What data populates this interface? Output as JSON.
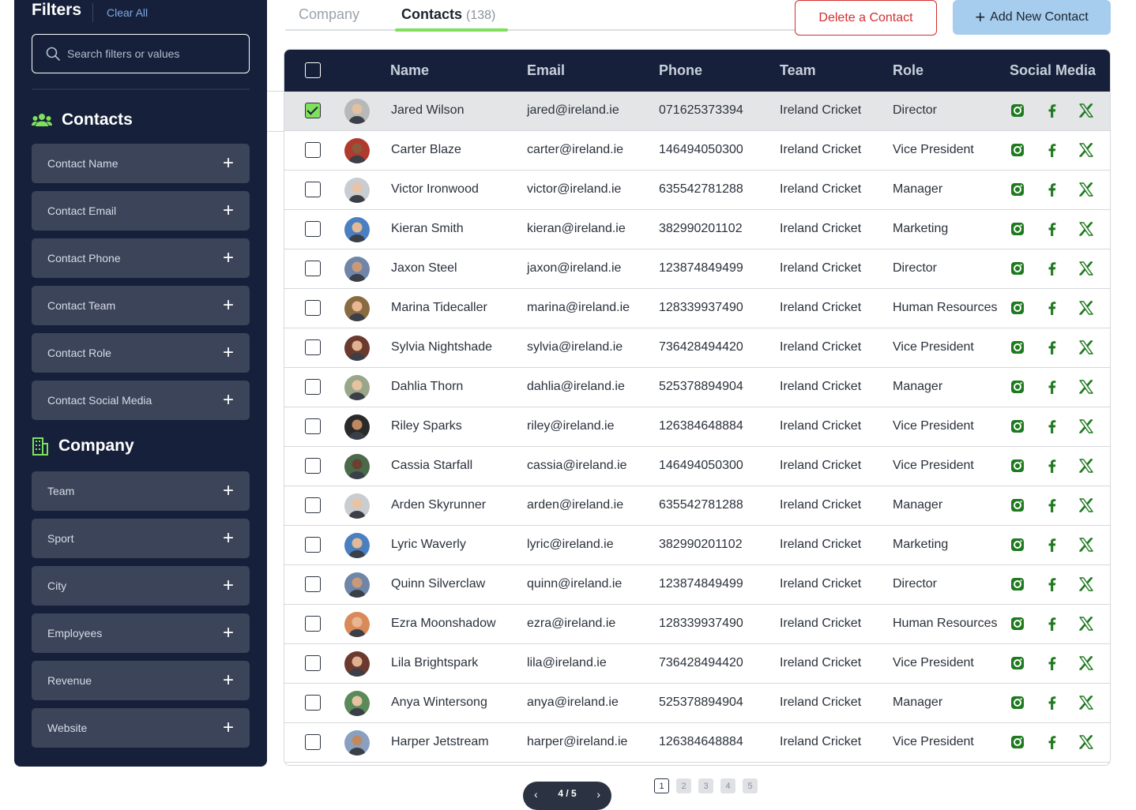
{
  "sidebar": {
    "title": "Filters",
    "clear_all": "Clear All",
    "search_placeholder": "Search filters or values",
    "contacts_title": "Contacts",
    "contacts_filters": [
      "Contact Name",
      "Contact Email",
      "Contact Phone",
      "Contact Team",
      "Contact Role",
      "Contact Social Media"
    ],
    "company_title": "Company",
    "company_filters": [
      "Team",
      "Sport",
      "City",
      "Employees",
      "Revenue",
      "Website"
    ],
    "icon_color": "#7ee05c"
  },
  "tabs": {
    "company": "Company",
    "contacts": "Contacts",
    "contacts_count": "(138)"
  },
  "actions": {
    "delete": "Delete a Contact",
    "add": "Add New Contact"
  },
  "table": {
    "headers": {
      "name": "Name",
      "email": "Email",
      "phone": "Phone",
      "team": "Team",
      "role": "Role",
      "social": "Social Media"
    },
    "rows": [
      {
        "name": "Jared Wilson",
        "email": "jared@ireland.ie",
        "phone": "071625373394",
        "team": "Ireland Cricket",
        "role": "Director",
        "checked": true,
        "avatar_bg": "#b8b8b8",
        "avatar_skin": "#e2c0a0"
      },
      {
        "name": "Carter Blaze",
        "email": "carter@ireland.ie",
        "phone": "146494050300",
        "team": "Ireland Cricket",
        "role": "Vice President",
        "checked": false,
        "avatar_bg": "#b03a2e",
        "avatar_skin": "#8a5a3c"
      },
      {
        "name": "Victor Ironwood",
        "email": "victor@ireland.ie",
        "phone": "635542781288",
        "team": "Ireland Cricket",
        "role": "Manager",
        "checked": false,
        "avatar_bg": "#c9ccd1",
        "avatar_skin": "#e8c4a5"
      },
      {
        "name": "Kieran Smith",
        "email": "kieran@ireland.ie",
        "phone": "382990201102",
        "team": "Ireland Cricket",
        "role": "Marketing",
        "checked": false,
        "avatar_bg": "#4a7fc1",
        "avatar_skin": "#e3b998"
      },
      {
        "name": "Jaxon Steel",
        "email": "jaxon@ireland.ie",
        "phone": "123874849499",
        "team": "Ireland Cricket",
        "role": "Director",
        "checked": false,
        "avatar_bg": "#6f86a8",
        "avatar_skin": "#c99a7a"
      },
      {
        "name": "Marina Tidecaller",
        "email": "marina@ireland.ie",
        "phone": "128339937490",
        "team": "Ireland Cricket",
        "role": "Human Resources",
        "checked": false,
        "avatar_bg": "#8a6a40",
        "avatar_skin": "#e8b690"
      },
      {
        "name": "Sylvia Nightshade",
        "email": "sylvia@ireland.ie",
        "phone": "736428494420",
        "team": "Ireland Cricket",
        "role": "Vice President",
        "checked": false,
        "avatar_bg": "#6b3a2e",
        "avatar_skin": "#e0b090"
      },
      {
        "name": "Dahlia Thorn",
        "email": "dahlia@ireland.ie",
        "phone": "525378894904",
        "team": "Ireland Cricket",
        "role": "Manager",
        "checked": false,
        "avatar_bg": "#9aa68a",
        "avatar_skin": "#e6c2a0"
      },
      {
        "name": "Riley Sparks",
        "email": "riley@ireland.ie",
        "phone": "126384648884",
        "team": "Ireland Cricket",
        "role": "Vice President",
        "checked": false,
        "avatar_bg": "#2a2a2a",
        "avatar_skin": "#c08a60"
      },
      {
        "name": "Cassia Starfall",
        "email": "cassia@ireland.ie",
        "phone": "146494050300",
        "team": "Ireland Cricket",
        "role": "Vice President",
        "checked": false,
        "avatar_bg": "#4a6a4a",
        "avatar_skin": "#6a4030"
      },
      {
        "name": "Arden Skyrunner",
        "email": "arden@ireland.ie",
        "phone": "635542781288",
        "team": "Ireland Cricket",
        "role": "Manager",
        "checked": false,
        "avatar_bg": "#c9ccd1",
        "avatar_skin": "#e8c4a5"
      },
      {
        "name": "Lyric Waverly",
        "email": "lyric@ireland.ie",
        "phone": "382990201102",
        "team": "Ireland Cricket",
        "role": "Marketing",
        "checked": false,
        "avatar_bg": "#4a7fc1",
        "avatar_skin": "#e3b998"
      },
      {
        "name": "Quinn Silverclaw",
        "email": "quinn@ireland.ie",
        "phone": "123874849499",
        "team": "Ireland Cricket",
        "role": "Director",
        "checked": false,
        "avatar_bg": "#6f86a8",
        "avatar_skin": "#c99a7a"
      },
      {
        "name": "Ezra Moonshadow",
        "email": "ezra@ireland.ie",
        "phone": "128339937490",
        "team": "Ireland Cricket",
        "role": "Human Resources",
        "checked": false,
        "avatar_bg": "#d98a5a",
        "avatar_skin": "#e8b690"
      },
      {
        "name": "Lila Brightspark",
        "email": "lila@ireland.ie",
        "phone": "736428494420",
        "team": "Ireland Cricket",
        "role": "Vice President",
        "checked": false,
        "avatar_bg": "#6b3a2e",
        "avatar_skin": "#e0b090"
      },
      {
        "name": "Anya Wintersong",
        "email": "anya@ireland.ie",
        "phone": "525378894904",
        "team": "Ireland Cricket",
        "role": "Manager",
        "checked": false,
        "avatar_bg": "#5a8a5a",
        "avatar_skin": "#e6c2a0"
      },
      {
        "name": "Harper Jetstream",
        "email": "harper@ireland.ie",
        "phone": "126384648884",
        "team": "Ireland Cricket",
        "role": "Vice President",
        "checked": false,
        "avatar_bg": "#8aa0c0",
        "avatar_skin": "#c08a60"
      }
    ],
    "social_color": "#1e7a1e"
  },
  "pagination": {
    "label": "4 / 5",
    "pages": [
      "1",
      "2",
      "3",
      "4",
      "5"
    ],
    "active_page": "1"
  }
}
